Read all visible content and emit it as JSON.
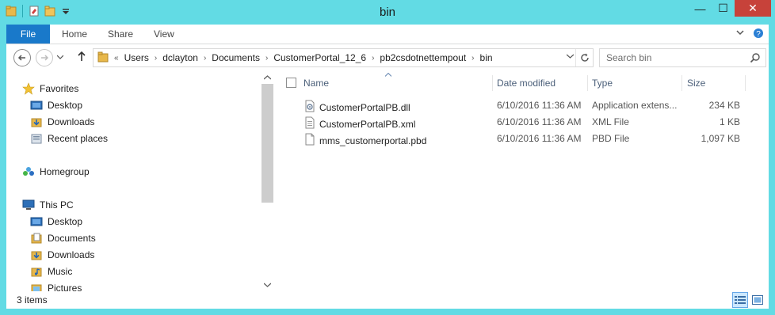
{
  "window": {
    "title": "bin",
    "controls": {
      "minimize": "—",
      "maximize": "☐",
      "close": "✕"
    }
  },
  "ribbon": {
    "tabs": [
      "File",
      "Home",
      "Share",
      "View"
    ]
  },
  "address": {
    "overflow": "«",
    "crumbs": [
      "Users",
      "dclayton",
      "Documents",
      "CustomerPortal_12_6",
      "pb2csdotnettempout",
      "bin"
    ]
  },
  "search": {
    "placeholder": "Search bin"
  },
  "nav": {
    "favorites": {
      "label": "Favorites",
      "items": [
        "Desktop",
        "Downloads",
        "Recent places"
      ]
    },
    "homegroup": {
      "label": "Homegroup"
    },
    "thispc": {
      "label": "This PC",
      "items": [
        "Desktop",
        "Documents",
        "Downloads",
        "Music",
        "Pictures"
      ]
    }
  },
  "columns": {
    "name": "Name",
    "date": "Date modified",
    "type": "Type",
    "size": "Size"
  },
  "files": [
    {
      "name": "CustomerPortalPB.dll",
      "date": "6/10/2016 11:36 AM",
      "type": "Application extens...",
      "size": "234 KB",
      "icon": "dll-icon"
    },
    {
      "name": "CustomerPortalPB.xml",
      "date": "6/10/2016 11:36 AM",
      "type": "XML File",
      "size": "1 KB",
      "icon": "xml-file-icon"
    },
    {
      "name": "mms_customerportal.pbd",
      "date": "6/10/2016 11:36 AM",
      "type": "PBD File",
      "size": "1,097 KB",
      "icon": "file-icon"
    }
  ],
  "status": {
    "count": "3 items"
  },
  "colors": {
    "frame": "#62dbe4",
    "file_tab": "#1979ca",
    "close": "#c7423a"
  }
}
